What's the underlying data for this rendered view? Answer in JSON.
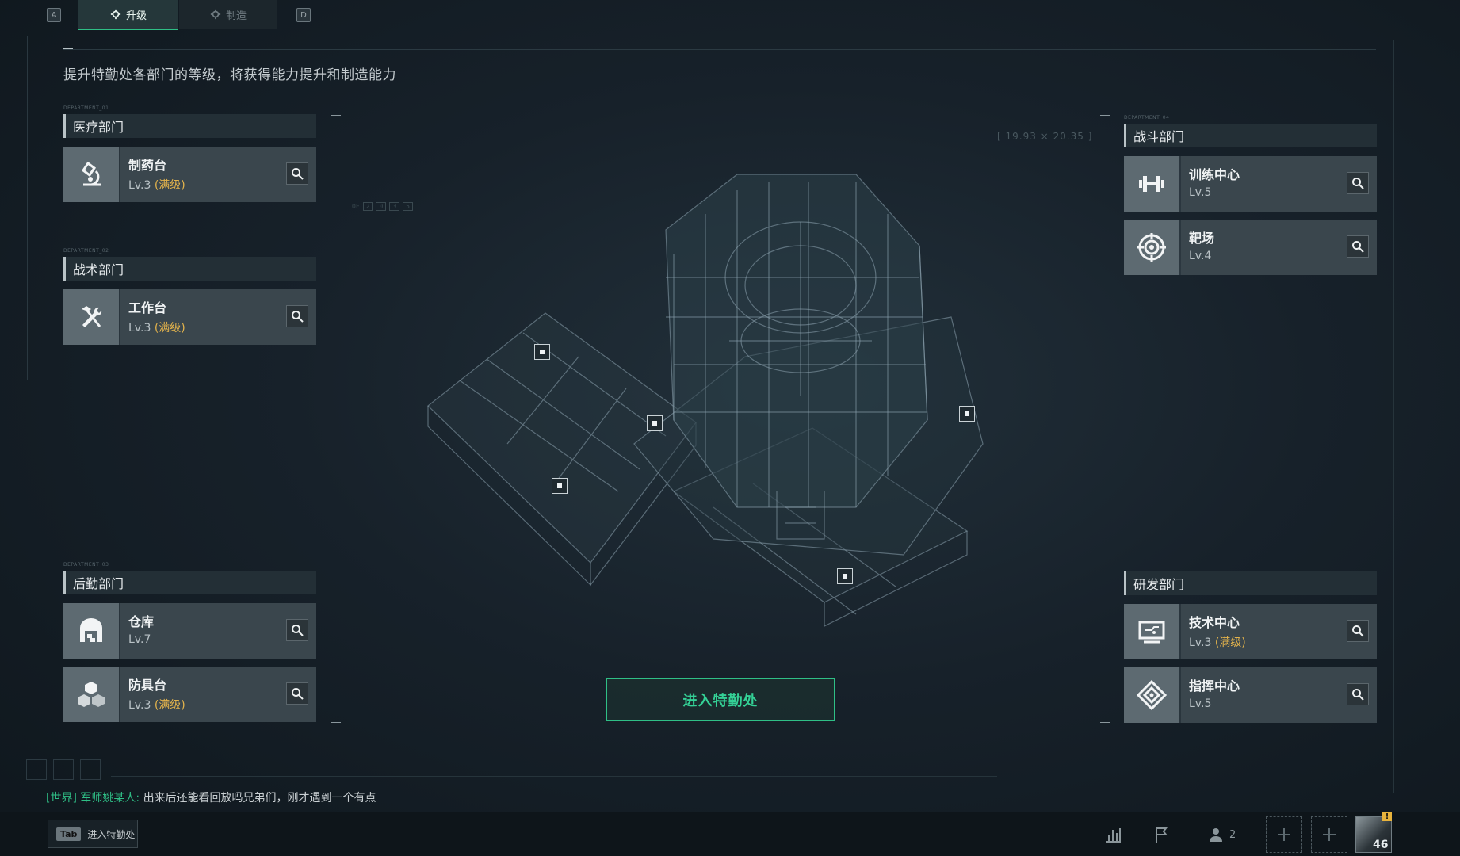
{
  "top": {
    "key_left": "A",
    "key_right": "D",
    "tabs": [
      {
        "label": "升级",
        "active": true
      },
      {
        "label": "制造",
        "active": false
      }
    ]
  },
  "subtitle": "提升特勤处各部门的等级，将获得能力提升和制造能力",
  "departments": {
    "medical": {
      "tag": "DEPARTMENT_01",
      "title": "医疗部门",
      "facilities": [
        {
          "name": "制药台",
          "level": "Lv.3",
          "maxed": "(满级)",
          "icon": "microscope-icon"
        }
      ]
    },
    "tactical": {
      "tag": "DEPARTMENT_02",
      "title": "战术部门",
      "facilities": [
        {
          "name": "工作台",
          "level": "Lv.3",
          "maxed": "(满级)",
          "icon": "hammer-wrench-icon"
        }
      ]
    },
    "logistics": {
      "tag": "DEPARTMENT_03",
      "title": "后勤部门",
      "facilities": [
        {
          "name": "仓库",
          "level": "Lv.7",
          "maxed": "",
          "icon": "warehouse-icon"
        },
        {
          "name": "防具台",
          "level": "Lv.3",
          "maxed": "(满级)",
          "icon": "armor-blocks-icon"
        }
      ]
    },
    "combat": {
      "tag": "DEPARTMENT_04",
      "title": "战斗部门",
      "facilities": [
        {
          "name": "训练中心",
          "level": "Lv.5",
          "maxed": "",
          "icon": "dumbbell-icon"
        },
        {
          "name": "靶场",
          "level": "Lv.4",
          "maxed": "",
          "icon": "target-icon"
        }
      ]
    },
    "research": {
      "title": "研发部门",
      "facilities": [
        {
          "name": "技术中心",
          "level": "Lv.3",
          "maxed": "(满级)",
          "icon": "tech-screen-icon"
        },
        {
          "name": "指挥中心",
          "level": "Lv.5",
          "maxed": "",
          "icon": "command-diamond-icon"
        }
      ]
    }
  },
  "center": {
    "coords": "[ 19.93 × 20.35 ]",
    "enter_button": "进入特勤处",
    "deco_of": "OF",
    "deco_digits": [
      "2",
      "0",
      "3",
      "5"
    ]
  },
  "chat": {
    "channel": "[世界]",
    "sender": "军师姚某人:",
    "message": "出来后还能看回放吗兄弟们，刚才遇到一个有点"
  },
  "footer": {
    "tab_key": "Tab",
    "tab_label": "进入特勤处",
    "team_count": "2",
    "avatar_level": "46",
    "notify": "!"
  },
  "colors": {
    "accent": "#2fbf86",
    "maxed": "#e3b34c",
    "background": "#17212a"
  }
}
